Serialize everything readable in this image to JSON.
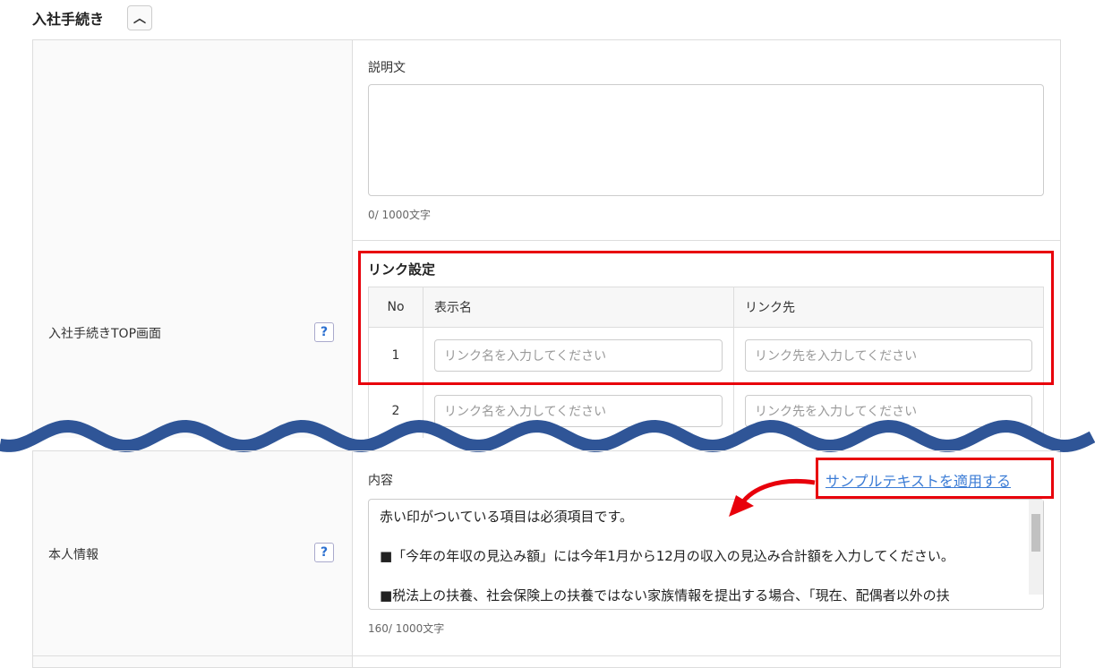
{
  "section": {
    "title": "入社手続き",
    "toggle_icon": "chevron-up-icon"
  },
  "row1": {
    "label": "入社手続きTOP画面",
    "help": "?",
    "description": {
      "label": "説明文",
      "value": "",
      "counter": "0/ 1000文字"
    },
    "links": {
      "title": "リンク設定",
      "headers": [
        "No",
        "表示名",
        "リンク先"
      ],
      "rows": [
        {
          "no": "1",
          "name_placeholder": "リンク名を入力してください",
          "url_placeholder": "リンク先を入力してください"
        },
        {
          "no": "2",
          "name_placeholder": "リンク名を入力してください",
          "url_placeholder": "リンク先を入力してください"
        }
      ]
    }
  },
  "row2": {
    "label": "本人情報",
    "help": "?",
    "content": {
      "label": "内容",
      "apply_link": "サンプルテキストを適用する",
      "lines": [
        "赤い印がついている項目は必須項目です。",
        "",
        "■「今年の年収の見込み額」には今年1月から12月の収入の見込み合計額を入力してください。",
        "",
        "■税法上の扶養、社会保険上の扶養ではない家族情報を提出する場合、「現在、配偶者以外の扶"
      ],
      "counter": "160/ 1000文字"
    }
  },
  "colors": {
    "highlight": "#e8000b",
    "wave": "#2f5597",
    "link": "#3a7bd5"
  }
}
